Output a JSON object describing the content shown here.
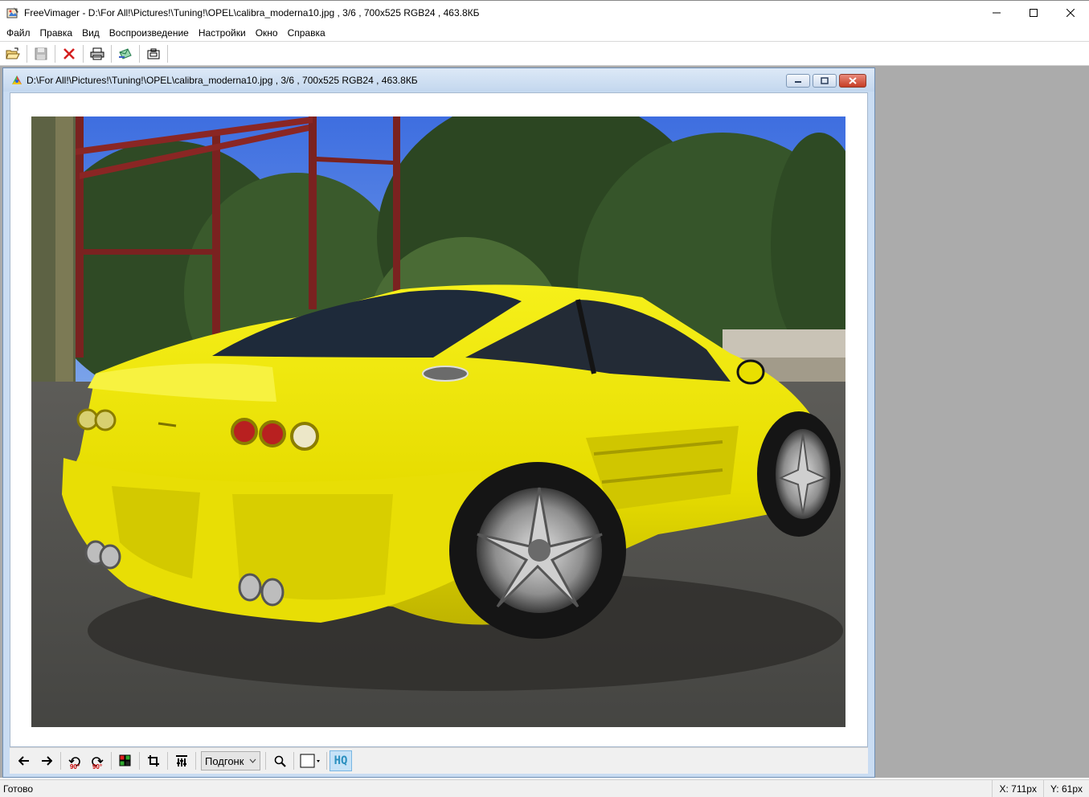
{
  "window": {
    "title": "FreeVimager - D:\\For All!\\Pictures!\\Tuning!\\OPEL\\calibra_moderna10.jpg , 3/6 , 700x525 RGB24 , 463.8КБ",
    "minimize_glyph": "─",
    "maximize_glyph": "☐",
    "close_glyph": "✕"
  },
  "menu": {
    "items": [
      {
        "label": "Файл"
      },
      {
        "label": "Правка"
      },
      {
        "label": "Вид"
      },
      {
        "label": "Воспроизведение"
      },
      {
        "label": "Настройки"
      },
      {
        "label": "Окно"
      },
      {
        "label": "Справка"
      }
    ]
  },
  "toolbar": {
    "icons": [
      "open-icon",
      "save-icon",
      "delete-icon",
      "print-icon",
      "email-icon",
      "screenshot-icon"
    ]
  },
  "child": {
    "title": "D:\\For All!\\Pictures!\\Tuning!\\OPEL\\calibra_moderna10.jpg , 3/6 , 700x525 RGB24 , 463.8КБ",
    "image_description_hidden": ""
  },
  "viewer_toolbar": {
    "rotate_left_label": "90°",
    "rotate_right_label": "90°",
    "zoom_value": "Подгонк",
    "hq_label": "HQ"
  },
  "status": {
    "text": "Готово",
    "x": "X: 711px",
    "y": "Y: 61px"
  },
  "colors": {
    "mdi_background": "#ababab",
    "child_frame": "#c9dcf2",
    "car_yellow": "#f2ea06",
    "hq_active": "#c6e2f7"
  }
}
